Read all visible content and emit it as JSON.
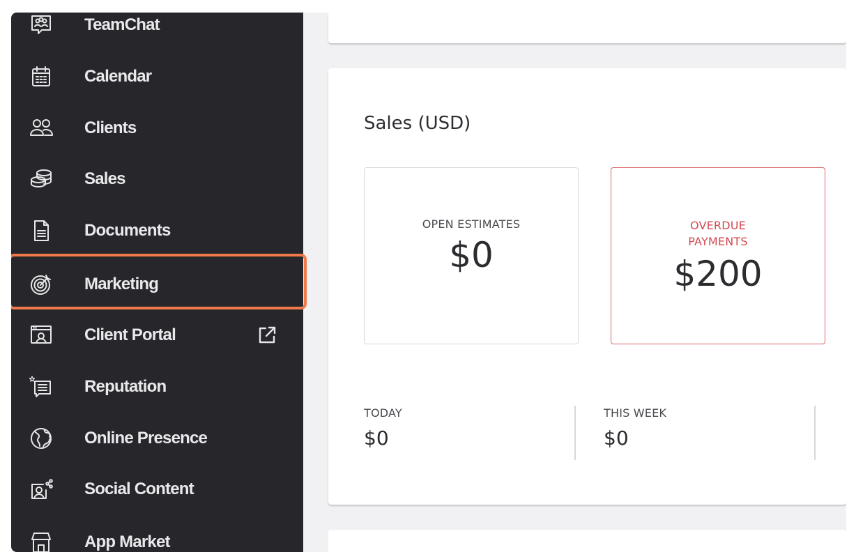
{
  "sidebar": {
    "items": [
      {
        "label": "TeamChat",
        "icon": "team-chat-icon"
      },
      {
        "label": "Calendar",
        "icon": "calendar-icon"
      },
      {
        "label": "Clients",
        "icon": "clients-icon"
      },
      {
        "label": "Sales",
        "icon": "coins-icon"
      },
      {
        "label": "Documents",
        "icon": "document-icon"
      },
      {
        "label": "Marketing",
        "icon": "target-icon",
        "highlighted": true
      },
      {
        "label": "Client Portal",
        "icon": "client-portal-icon",
        "trailing_icon": "external-link-icon"
      },
      {
        "label": "Reputation",
        "icon": "reputation-icon"
      },
      {
        "label": "Online Presence",
        "icon": "globe-icon"
      },
      {
        "label": "Social Content",
        "icon": "social-content-icon"
      },
      {
        "label": "App Market",
        "icon": "store-icon"
      }
    ],
    "highlight_color": "#f07a4a"
  },
  "sales": {
    "title": "Sales",
    "currency": "(USD)",
    "open_estimates": {
      "label": "OPEN ESTIMATES",
      "value": "$0"
    },
    "overdue_payments": {
      "label_line1": "OVERDUE",
      "label_line2": "PAYMENTS",
      "value": "$200",
      "color": "#d24a51"
    },
    "periods": [
      {
        "label": "TODAY",
        "value": "$0"
      },
      {
        "label": "THIS WEEK",
        "value": "$0"
      },
      {
        "label": "",
        "value": ""
      }
    ]
  }
}
